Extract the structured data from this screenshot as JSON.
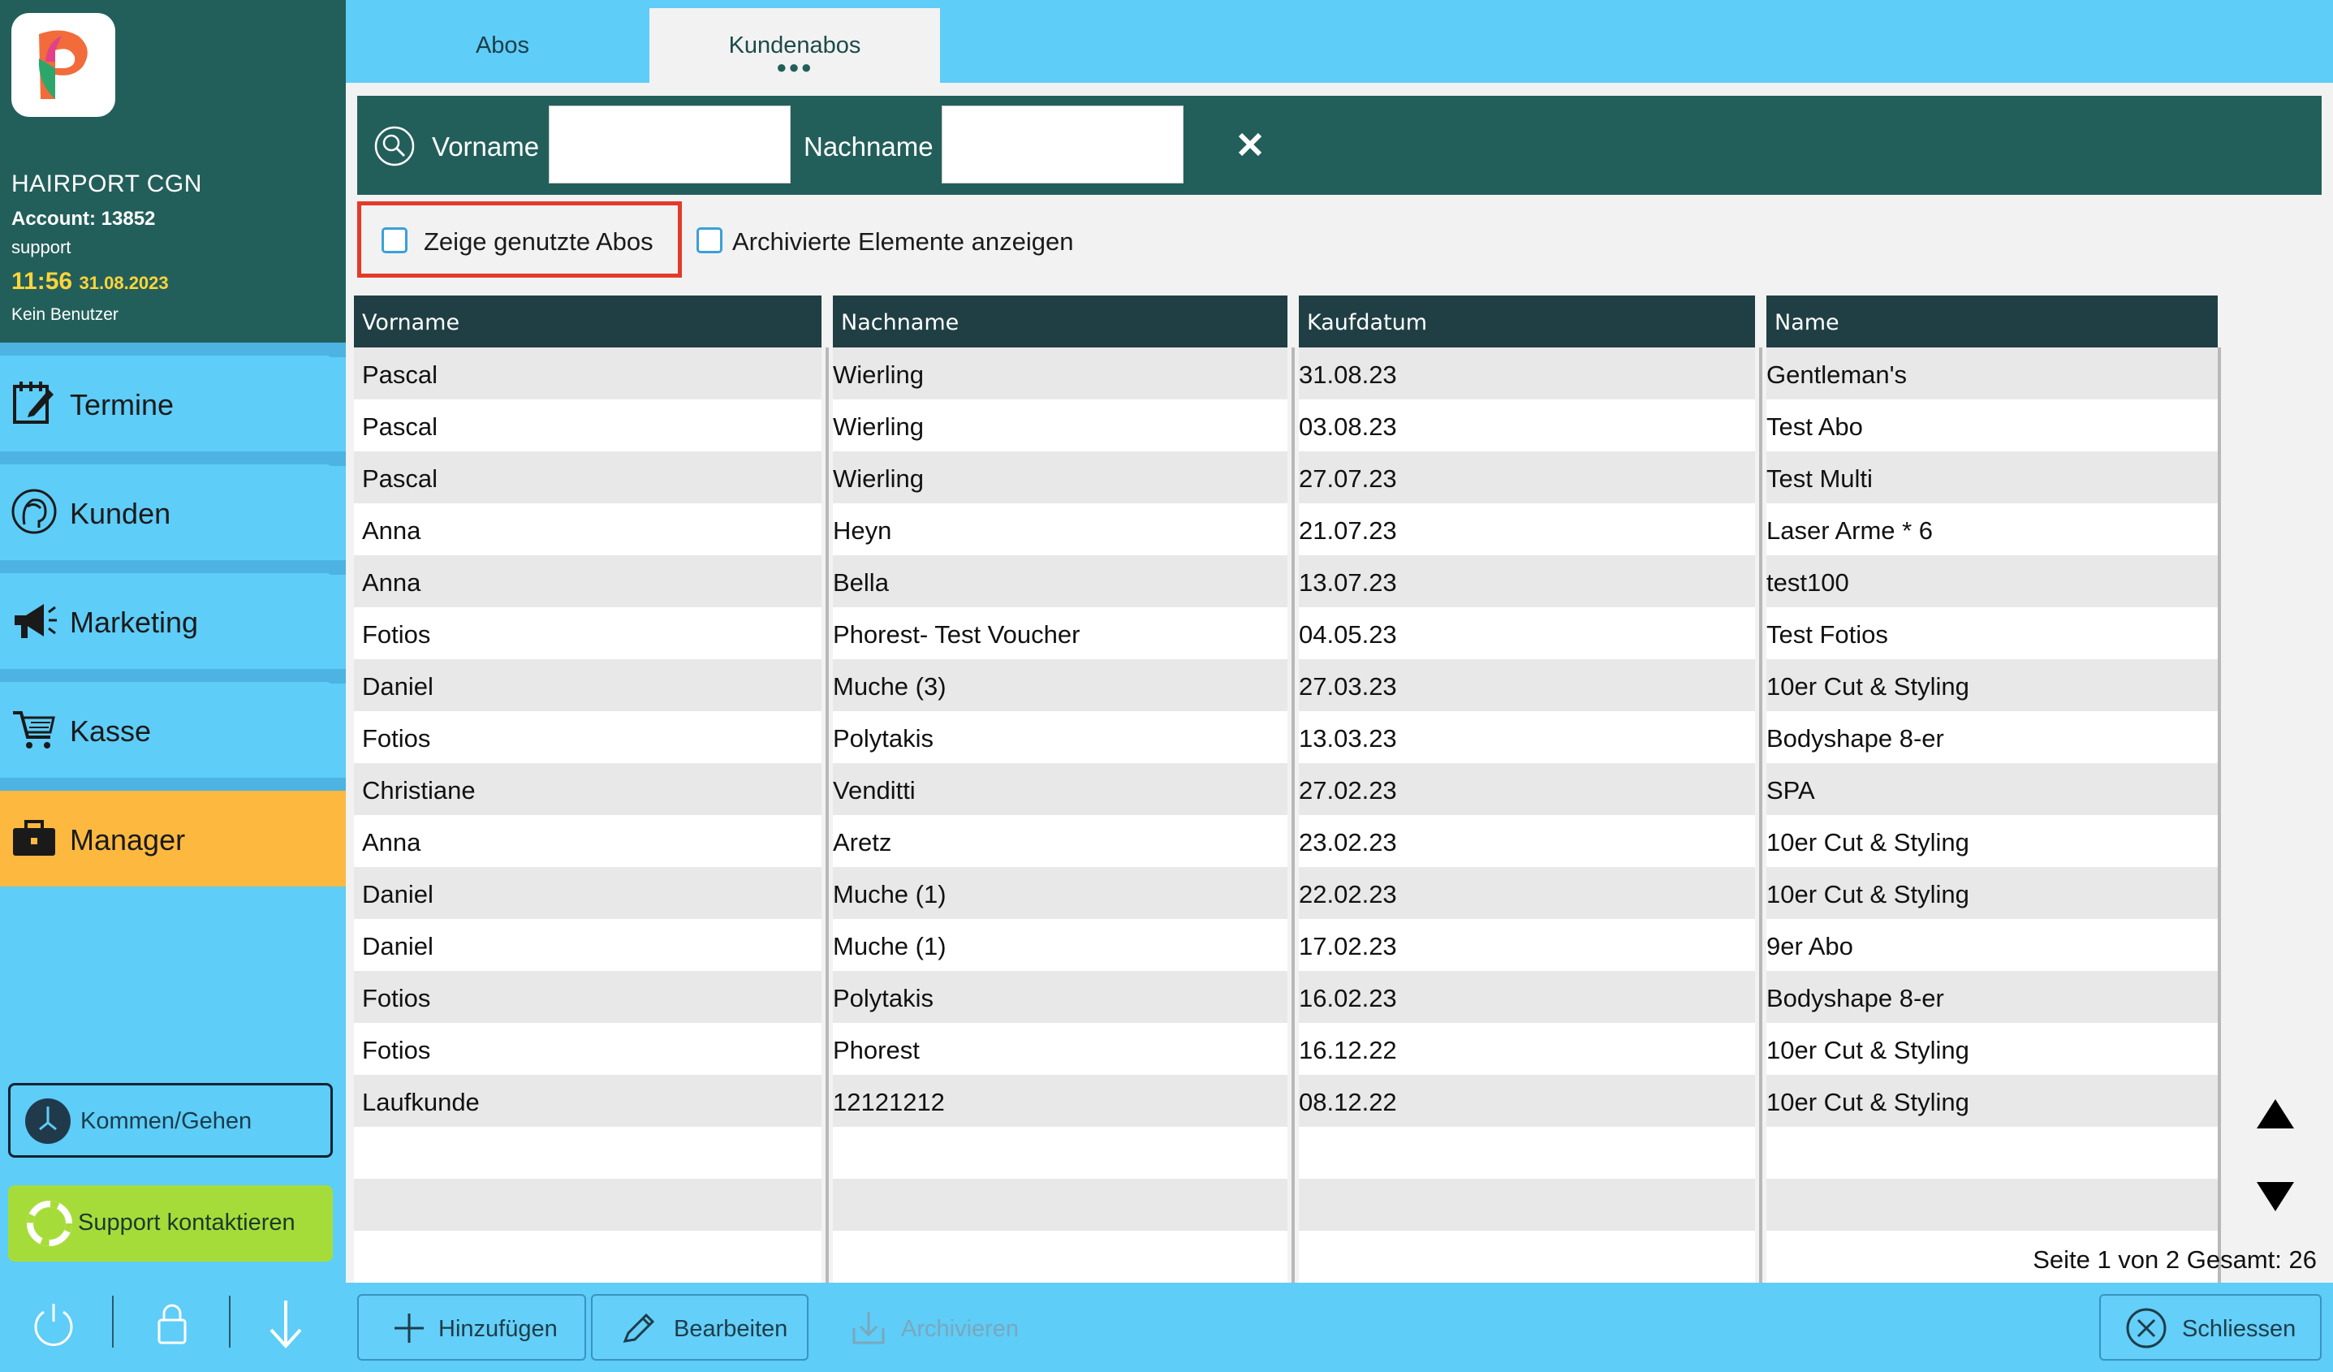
{
  "sidebar": {
    "salon_name": "HAIRPORT CGN",
    "account": "Account: 13852",
    "role": "support",
    "time": "11:56",
    "date": "31.08.2023",
    "user": "Kein Benutzer",
    "nav": [
      {
        "label": "Termine",
        "icon": "calendar-edit-icon"
      },
      {
        "label": "Kunden",
        "icon": "customer-head-icon"
      },
      {
        "label": "Marketing",
        "icon": "megaphone-icon"
      },
      {
        "label": "Kasse",
        "icon": "shopping-cart-icon"
      },
      {
        "label": "Manager",
        "icon": "briefcase-icon",
        "active": true
      }
    ],
    "kommen_gehen": "Kommen/Gehen",
    "support": "Support kontaktieren"
  },
  "tabs": [
    {
      "label": "Abos"
    },
    {
      "label": "Kundenabos",
      "active": true,
      "dots": "●●●"
    }
  ],
  "search": {
    "vorname_label": "Vorname",
    "vorname_value": "",
    "nachname_label": "Nachname",
    "nachname_value": ""
  },
  "filters": {
    "used_label": "Zeige genutzte Abos",
    "archived_label": "Archivierte Elemente anzeigen"
  },
  "table": {
    "columns": [
      "Vorname",
      "Nachname",
      "Kaufdatum",
      "Name"
    ],
    "rows": [
      [
        "Pascal",
        "Wierling",
        "31.08.23",
        "Gentleman's"
      ],
      [
        "Pascal",
        "Wierling",
        "03.08.23",
        "Test Abo"
      ],
      [
        "Pascal",
        "Wierling",
        "27.07.23",
        "Test Multi"
      ],
      [
        "Anna",
        "Heyn",
        "21.07.23",
        "Laser Arme * 6"
      ],
      [
        "Anna",
        "Bella",
        "13.07.23",
        "test100"
      ],
      [
        "Fotios",
        "Phorest- Test Voucher",
        "04.05.23",
        "Test Fotios"
      ],
      [
        "Daniel",
        "Muche (3)",
        "27.03.23",
        "10er Cut & Styling"
      ],
      [
        "Fotios",
        "Polytakis",
        "13.03.23",
        "Bodyshape 8-er"
      ],
      [
        "Christiane",
        "Venditti",
        "27.02.23",
        "SPA"
      ],
      [
        "Anna",
        "Aretz",
        "23.02.23",
        "10er Cut & Styling"
      ],
      [
        "Daniel",
        "Muche (1)",
        "22.02.23",
        "10er Cut & Styling"
      ],
      [
        "Daniel",
        "Muche (1)",
        "17.02.23",
        "9er Abo"
      ],
      [
        "Fotios",
        "Polytakis",
        "16.02.23",
        "Bodyshape 8-er"
      ],
      [
        "Fotios",
        "Phorest",
        "16.12.22",
        "10er Cut & Styling"
      ],
      [
        "Laufkunde",
        "12121212",
        "08.12.22",
        "10er Cut & Styling"
      ]
    ]
  },
  "pager": "Seite 1 von 2 Gesamt: 26",
  "footer": {
    "add": "Hinzufügen",
    "edit": "Bearbeiten",
    "archive": "Archivieren",
    "close": "Schliessen"
  },
  "colors": {
    "dark_teal": "#235f5a",
    "sky_blue": "#5ecdf8",
    "manager_orange": "#fdb840",
    "support_green": "#a6dc3a",
    "highlight_red": "#e43a2a"
  }
}
